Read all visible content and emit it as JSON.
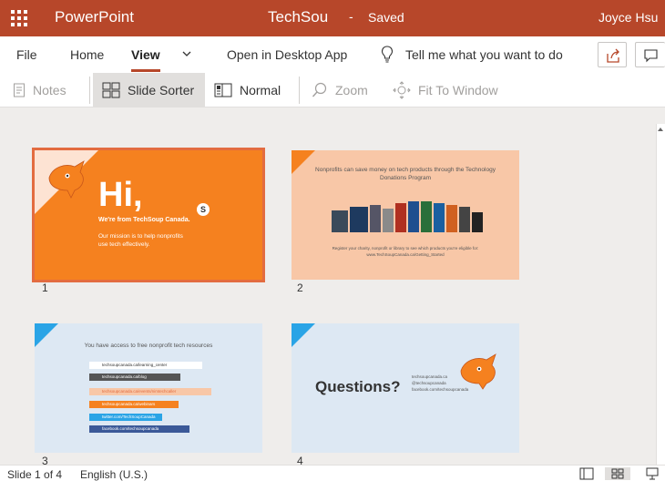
{
  "titlebar": {
    "app_name": "PowerPoint",
    "doc_name": "TechSou",
    "separator": "-",
    "save_status": "Saved",
    "user_name": "Joyce Hsu"
  },
  "menu": {
    "file": "File",
    "home": "Home",
    "view": "View",
    "open_desktop": "Open in Desktop App",
    "tell_me": "Tell me what you want to do"
  },
  "toolbar": {
    "notes": "Notes",
    "slide_sorter": "Slide Sorter",
    "normal": "Normal",
    "zoom": "Zoom",
    "fit_to_window": "Fit To Window"
  },
  "slides": [
    {
      "number": "1",
      "title": "Hi,",
      "line1": "We're from TechSoup Canada.",
      "line2": "Our mission is to help nonprofits use tech effectively.",
      "badge": "S"
    },
    {
      "number": "2",
      "headline": "Nonprofits can save money on tech products through the Technology Donations Program",
      "footer": "Register your charity, nonprofit or library to see which products you're eligible for: www.TechSoupCanada.ca/Getting_Started"
    },
    {
      "number": "3",
      "headline": "You have access to free nonprofit tech resources",
      "links": [
        "techsoupcanada.ca/learning_center",
        "techsoupcanada.ca/blog",
        "techsoupcanada.ca/events/nimtechcaller",
        "techsoupcanada.ca/webinars",
        "twitter.com/TechSoupCanada",
        "facebook.com/techsoupcanada"
      ]
    },
    {
      "number": "4",
      "title": "Questions?",
      "contacts": [
        "techsoupcanada.ca",
        "@techsoupcanada",
        "facebook.com/techsoupcanada"
      ]
    }
  ],
  "statusbar": {
    "slide_count": "Slide 1 of 4",
    "language": "English (U.S.)"
  },
  "colors": {
    "brand": "#b7472a",
    "slide_orange": "#f5811f",
    "slide_peach": "#f8c7a7",
    "slide_blue": "#dde8f3",
    "accent_blue": "#2aa4e6",
    "selection": "#e36c40"
  },
  "icons": {
    "waffle": "app-launcher-icon",
    "chevron": "chevron-down-icon",
    "bulb": "lightbulb-icon",
    "share": "share-icon",
    "comment": "comment-icon",
    "notes": "notes-icon",
    "slide_sorter": "slide-sorter-icon",
    "normal": "normal-view-icon",
    "zoom": "zoom-icon",
    "fit": "fit-to-window-icon"
  }
}
